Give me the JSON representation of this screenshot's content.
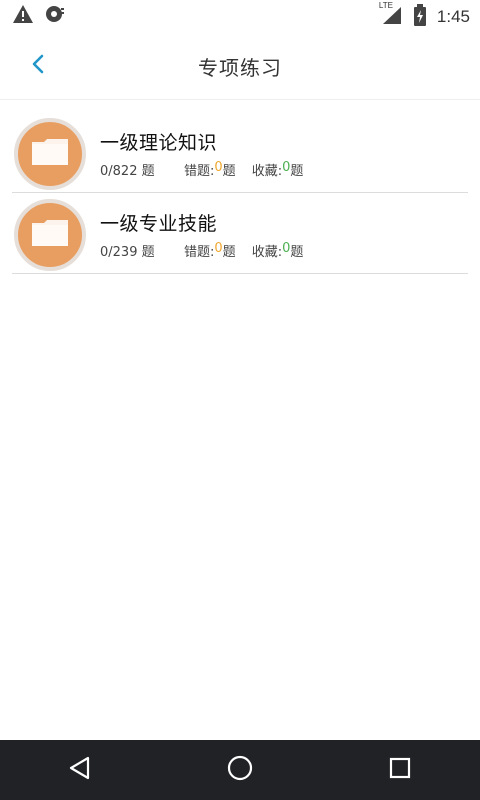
{
  "status_bar": {
    "network_label": "LTE",
    "time": "1:45",
    "icons": [
      "warning-icon",
      "sync-icon",
      "signal-icon",
      "battery-charging-icon"
    ]
  },
  "header": {
    "title": "专项练习",
    "back_icon": "chevron-left-icon",
    "accent_color": "#2196c9"
  },
  "items": [
    {
      "title": "一级理论知识",
      "progress": "0/822 题",
      "wrong_label": "错题:",
      "wrong_count": "0",
      "wrong_unit": "题",
      "fav_label": "收藏:",
      "fav_count": "0",
      "fav_unit": "题",
      "icon": "folder-icon"
    },
    {
      "title": "一级专业技能",
      "progress": "0/239 题",
      "wrong_label": "错题:",
      "wrong_count": "0",
      "wrong_unit": "题",
      "fav_label": "收藏:",
      "fav_count": "0",
      "fav_unit": "题",
      "icon": "folder-icon"
    }
  ],
  "colors": {
    "folder_bg": "#e89e60",
    "wrong_count": "#f0a830",
    "fav_count": "#4caf50",
    "nav_bar": "#202226"
  },
  "nav": {
    "icons": [
      "back-triangle-icon",
      "home-circle-icon",
      "recents-square-icon"
    ]
  }
}
